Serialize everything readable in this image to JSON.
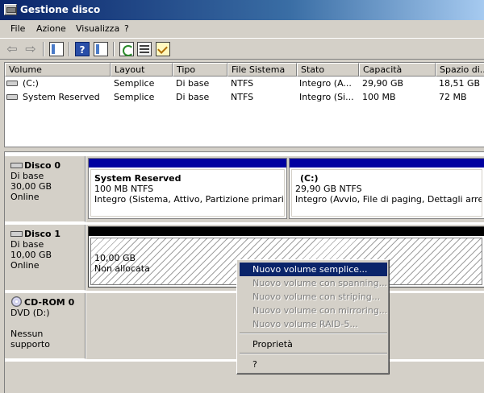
{
  "window": {
    "title": "Gestione disco"
  },
  "menu": {
    "items": [
      "File",
      "Azione",
      "Visualizza",
      "?"
    ]
  },
  "toolbar": {
    "icons": [
      "back-arrow-icon",
      "forward-arrow-icon",
      "show-hide-tree-icon",
      "help-icon",
      "show-hide-action-pane-icon",
      "refresh-icon",
      "properties-icon",
      "check-icon"
    ],
    "back_glyph": "⇦",
    "forward_glyph": "⇨",
    "help_glyph": "?"
  },
  "volume_list": {
    "columns": [
      "Volume",
      "Layout",
      "Tipo",
      "File Sistema",
      "Stato",
      "Capacità",
      "Spazio di..."
    ],
    "rows": [
      {
        "volume": "(C:)",
        "layout": "Semplice",
        "tipo": "Di base",
        "fs": "NTFS",
        "stato": "Integro (A...",
        "capacita": "29,90 GB",
        "spazio": "18,51 GB"
      },
      {
        "volume": "System Reserved",
        "layout": "Semplice",
        "tipo": "Di base",
        "fs": "NTFS",
        "stato": "Integro (Si...",
        "capacita": "100 MB",
        "spazio": "72 MB"
      }
    ]
  },
  "disks": [
    {
      "name": "Disco 0",
      "type": "Di base",
      "size": "30,00 GB",
      "status": "Online",
      "partitions": [
        {
          "title": "System Reserved",
          "size": "100 MB NTFS",
          "status": "Integro (Sistema, Attivo, Partizione primaria)",
          "bar_color": "#0000a0"
        },
        {
          "title": "(C:)",
          "size": "29,90 GB NTFS",
          "status": "Integro (Avvio, File di paging, Dettagli arresto anomalo)",
          "bar_color": "#0000a0"
        }
      ]
    },
    {
      "name": "Disco 1",
      "type": "Di base",
      "size": "10,00 GB",
      "status": "Online",
      "partitions": [
        {
          "title": "",
          "size": "10,00 GB",
          "status": "Non allocata",
          "bar_color": "#000000"
        }
      ]
    },
    {
      "name": "CD-ROM 0",
      "type": "DVD (D:)",
      "size": "",
      "status": "Nessun supporto",
      "partitions": []
    }
  ],
  "context_menu": {
    "items": [
      {
        "label": "Nuovo volume semplice...",
        "state": "selected"
      },
      {
        "label": "Nuovo volume con spanning...",
        "state": "disabled"
      },
      {
        "label": "Nuovo volume con striping...",
        "state": "disabled"
      },
      {
        "label": "Nuovo volume con mirroring...",
        "state": "disabled"
      },
      {
        "label": "Nuovo volume RAID-5...",
        "state": "disabled"
      },
      {
        "label": "Proprietà",
        "state": "enabled"
      },
      {
        "label": "?",
        "state": "enabled"
      }
    ]
  }
}
